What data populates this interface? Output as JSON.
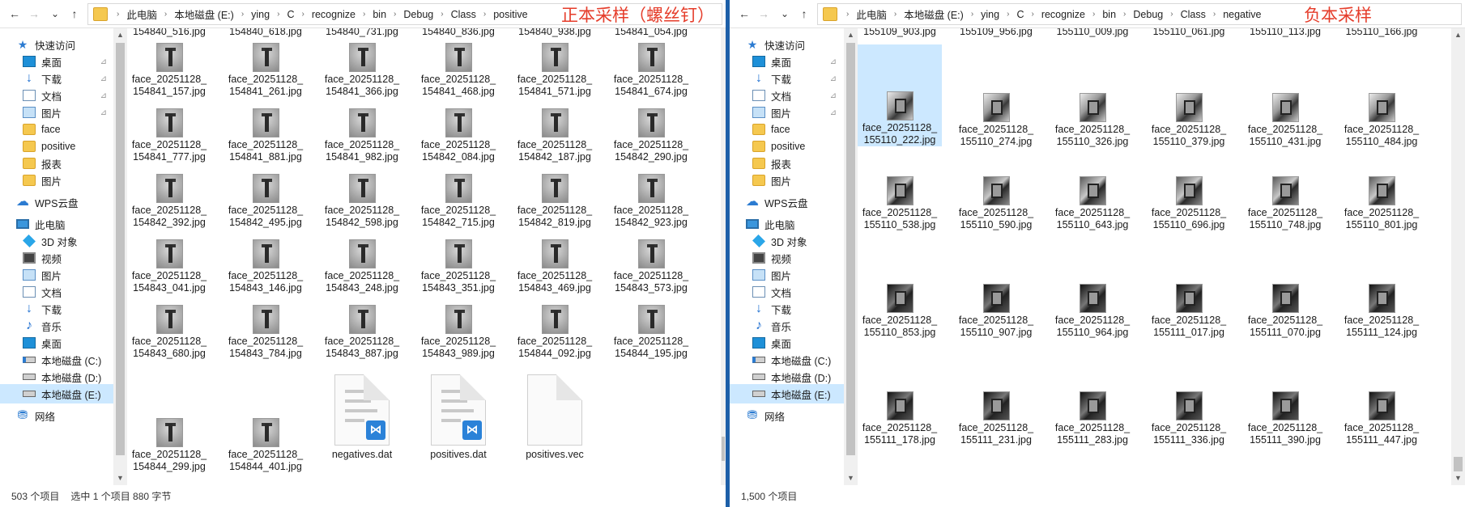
{
  "left": {
    "nav": {
      "back": "←",
      "forward": "→",
      "recent": "⌄",
      "up": "↑"
    },
    "breadcrumbs": [
      "此电脑",
      "本地磁盘 (E:)",
      "ying",
      "C",
      "recognize",
      "bin",
      "Debug",
      "Class",
      "positive"
    ],
    "annotation": "正本采样（螺丝钉）",
    "sidebar": [
      {
        "label": "快速访问",
        "icon": "star-icon"
      },
      {
        "label": "桌面",
        "icon": "desktop-icon",
        "pinned": true
      },
      {
        "label": "下载",
        "icon": "download-icon",
        "pinned": true
      },
      {
        "label": "文档",
        "icon": "document-icon",
        "pinned": true
      },
      {
        "label": "图片",
        "icon": "picture-icon",
        "pinned": true
      },
      {
        "label": "face",
        "icon": "folder-icon"
      },
      {
        "label": "positive",
        "icon": "folder-icon"
      },
      {
        "label": "报表",
        "icon": "folder-icon"
      },
      {
        "label": "图片",
        "icon": "folder-icon"
      },
      {
        "label": "WPS云盘",
        "icon": "cloud-icon"
      },
      {
        "label": "此电脑",
        "icon": "computer-icon"
      },
      {
        "label": "3D 对象",
        "icon": "3d-objects-icon"
      },
      {
        "label": "视频",
        "icon": "video-icon"
      },
      {
        "label": "图片",
        "icon": "picture-icon"
      },
      {
        "label": "文档",
        "icon": "document-icon"
      },
      {
        "label": "下载",
        "icon": "download-icon"
      },
      {
        "label": "音乐",
        "icon": "music-icon"
      },
      {
        "label": "桌面",
        "icon": "desktop-icon"
      },
      {
        "label": "本地磁盘 (C:)",
        "icon": "system-drive-icon"
      },
      {
        "label": "本地磁盘 (D:)",
        "icon": "drive-icon"
      },
      {
        "label": "本地磁盘 (E:)",
        "icon": "drive-icon",
        "selected": true
      },
      {
        "label": "网络",
        "icon": "network-icon"
      }
    ],
    "top_partial_files": [
      "154840_516.jpg",
      "154840_618.jpg",
      "154840_731.jpg",
      "154840_836.jpg",
      "154840_938.jpg",
      "154841_054.jpg"
    ],
    "rows": [
      [
        [
          "face_20251128_",
          "154841_157.jpg"
        ],
        [
          "face_20251128_",
          "154841_261.jpg"
        ],
        [
          "face_20251128_",
          "154841_366.jpg"
        ],
        [
          "face_20251128_",
          "154841_468.jpg"
        ],
        [
          "face_20251128_",
          "154841_571.jpg"
        ],
        [
          "face_20251128_",
          "154841_674.jpg"
        ]
      ],
      [
        [
          "face_20251128_",
          "154841_777.jpg"
        ],
        [
          "face_20251128_",
          "154841_881.jpg"
        ],
        [
          "face_20251128_",
          "154841_982.jpg"
        ],
        [
          "face_20251128_",
          "154842_084.jpg"
        ],
        [
          "face_20251128_",
          "154842_187.jpg"
        ],
        [
          "face_20251128_",
          "154842_290.jpg"
        ]
      ],
      [
        [
          "face_20251128_",
          "154842_392.jpg"
        ],
        [
          "face_20251128_",
          "154842_495.jpg"
        ],
        [
          "face_20251128_",
          "154842_598.jpg"
        ],
        [
          "face_20251128_",
          "154842_715.jpg"
        ],
        [
          "face_20251128_",
          "154842_819.jpg"
        ],
        [
          "face_20251128_",
          "154842_923.jpg"
        ]
      ],
      [
        [
          "face_20251128_",
          "154843_041.jpg"
        ],
        [
          "face_20251128_",
          "154843_146.jpg"
        ],
        [
          "face_20251128_",
          "154843_248.jpg"
        ],
        [
          "face_20251128_",
          "154843_351.jpg"
        ],
        [
          "face_20251128_",
          "154843_469.jpg"
        ],
        [
          "face_20251128_",
          "154843_573.jpg"
        ]
      ],
      [
        [
          "face_20251128_",
          "154843_680.jpg"
        ],
        [
          "face_20251128_",
          "154843_784.jpg"
        ],
        [
          "face_20251128_",
          "154843_887.jpg"
        ],
        [
          "face_20251128_",
          "154843_989.jpg"
        ],
        [
          "face_20251128_",
          "154844_092.jpg"
        ],
        [
          "face_20251128_",
          "154844_195.jpg"
        ]
      ]
    ],
    "last_images": [
      [
        "face_20251128_",
        "154844_299.jpg"
      ],
      [
        "face_20251128_",
        "154844_401.jpg"
      ]
    ],
    "doc_files": [
      {
        "name": "negatives.dat",
        "vs": true
      },
      {
        "name": "positives.dat",
        "vs": true
      },
      {
        "name": "positives.vec",
        "vs": false
      }
    ],
    "status": {
      "count": "503 个项目",
      "selection": "选中 1 个项目  880 字节"
    }
  },
  "right": {
    "nav": {
      "back": "←",
      "forward": "→",
      "recent": "⌄",
      "up": "↑"
    },
    "breadcrumbs": [
      "此电脑",
      "本地磁盘 (E:)",
      "ying",
      "C",
      "recognize",
      "bin",
      "Debug",
      "Class",
      "negative"
    ],
    "annotation": "负本采样",
    "sidebar": [
      {
        "label": "快速访问",
        "icon": "star-icon"
      },
      {
        "label": "桌面",
        "icon": "desktop-icon",
        "pinned": true
      },
      {
        "label": "下载",
        "icon": "download-icon",
        "pinned": true
      },
      {
        "label": "文档",
        "icon": "document-icon",
        "pinned": true
      },
      {
        "label": "图片",
        "icon": "picture-icon",
        "pinned": true
      },
      {
        "label": "face",
        "icon": "folder-icon"
      },
      {
        "label": "positive",
        "icon": "folder-icon"
      },
      {
        "label": "报表",
        "icon": "folder-icon"
      },
      {
        "label": "图片",
        "icon": "folder-icon"
      },
      {
        "label": "WPS云盘",
        "icon": "cloud-icon"
      },
      {
        "label": "此电脑",
        "icon": "computer-icon"
      },
      {
        "label": "3D 对象",
        "icon": "3d-objects-icon"
      },
      {
        "label": "视频",
        "icon": "video-icon"
      },
      {
        "label": "图片",
        "icon": "picture-icon"
      },
      {
        "label": "文档",
        "icon": "document-icon"
      },
      {
        "label": "下载",
        "icon": "download-icon"
      },
      {
        "label": "音乐",
        "icon": "music-icon"
      },
      {
        "label": "桌面",
        "icon": "desktop-icon"
      },
      {
        "label": "本地磁盘 (C:)",
        "icon": "system-drive-icon"
      },
      {
        "label": "本地磁盘 (D:)",
        "icon": "drive-icon"
      },
      {
        "label": "本地磁盘 (E:)",
        "icon": "drive-icon",
        "selected": true
      },
      {
        "label": "网络",
        "icon": "network-icon"
      }
    ],
    "top_partial_files": [
      "155109_903.jpg",
      "155109_956.jpg",
      "155110_009.jpg",
      "155110_061.jpg",
      "155110_113.jpg",
      "155110_166.jpg"
    ],
    "rows": [
      [
        [
          "face_20251128_",
          "155110_222.jpg"
        ],
        [
          "face_20251128_",
          "155110_274.jpg"
        ],
        [
          "face_20251128_",
          "155110_326.jpg"
        ],
        [
          "face_20251128_",
          "155110_379.jpg"
        ],
        [
          "face_20251128_",
          "155110_431.jpg"
        ],
        [
          "face_20251128_",
          "155110_484.jpg"
        ]
      ],
      [
        [
          "face_20251128_",
          "155110_538.jpg"
        ],
        [
          "face_20251128_",
          "155110_590.jpg"
        ],
        [
          "face_20251128_",
          "155110_643.jpg"
        ],
        [
          "face_20251128_",
          "155110_696.jpg"
        ],
        [
          "face_20251128_",
          "155110_748.jpg"
        ],
        [
          "face_20251128_",
          "155110_801.jpg"
        ]
      ],
      [
        [
          "face_20251128_",
          "155110_853.jpg"
        ],
        [
          "face_20251128_",
          "155110_907.jpg"
        ],
        [
          "face_20251128_",
          "155110_964.jpg"
        ],
        [
          "face_20251128_",
          "155111_017.jpg"
        ],
        [
          "face_20251128_",
          "155111_070.jpg"
        ],
        [
          "face_20251128_",
          "155111_124.jpg"
        ]
      ],
      [
        [
          "face_20251128_",
          "155111_178.jpg"
        ],
        [
          "face_20251128_",
          "155111_231.jpg"
        ],
        [
          "face_20251128_",
          "155111_283.jpg"
        ],
        [
          "face_20251128_",
          "155111_336.jpg"
        ],
        [
          "face_20251128_",
          "155111_390.jpg"
        ],
        [
          "face_20251128_",
          "155111_447.jpg"
        ]
      ]
    ],
    "status": {
      "count": "1,500 个项目"
    }
  }
}
